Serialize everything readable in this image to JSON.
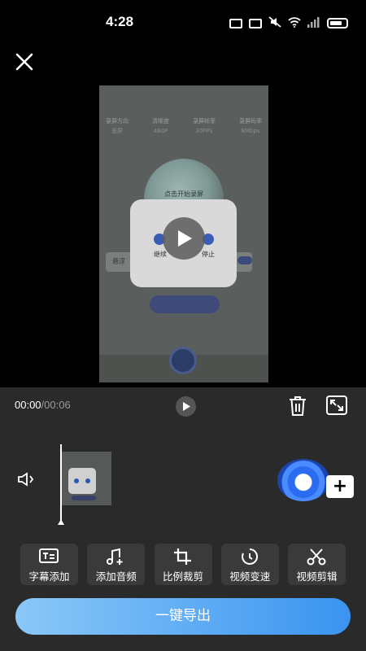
{
  "status_bar": {
    "time": "4:28",
    "icons": [
      "nfc-icon",
      "n-icon",
      "mute-icon",
      "wifi-icon",
      "signal-icon",
      "battery-icon"
    ]
  },
  "toolbar": {
    "close_icon": "close-icon"
  },
  "preview": {
    "settings": [
      {
        "label": "录屏方向",
        "value": "竖屏"
      },
      {
        "label": "清晰度",
        "value": "480P"
      },
      {
        "label": "录屏帧率",
        "value": "30FPS"
      },
      {
        "label": "录屏码率",
        "value": "8Mbps"
      }
    ],
    "start_text": "点击开始录屏",
    "pause_card": {
      "continue_label": "继续",
      "stop_label": "停止"
    },
    "floating_label": "悬浮"
  },
  "playback": {
    "current_time": "00:00",
    "total_time": "/00:06"
  },
  "tools": [
    {
      "label": "字幕添加",
      "icon": "subtitle-icon"
    },
    {
      "label": "添加音频",
      "icon": "music-add-icon"
    },
    {
      "label": "比例裁剪",
      "icon": "crop-icon"
    },
    {
      "label": "视频变速",
      "icon": "speed-icon"
    },
    {
      "label": "视频剪辑",
      "icon": "scissors-icon"
    }
  ],
  "add_label": "+",
  "export_label": "一键导出",
  "colors": {
    "editor_bg": "#2a2a2a",
    "tool_bg": "#3a3a3a",
    "export_start": "#8ac8f8",
    "export_end": "#3a94f0"
  }
}
